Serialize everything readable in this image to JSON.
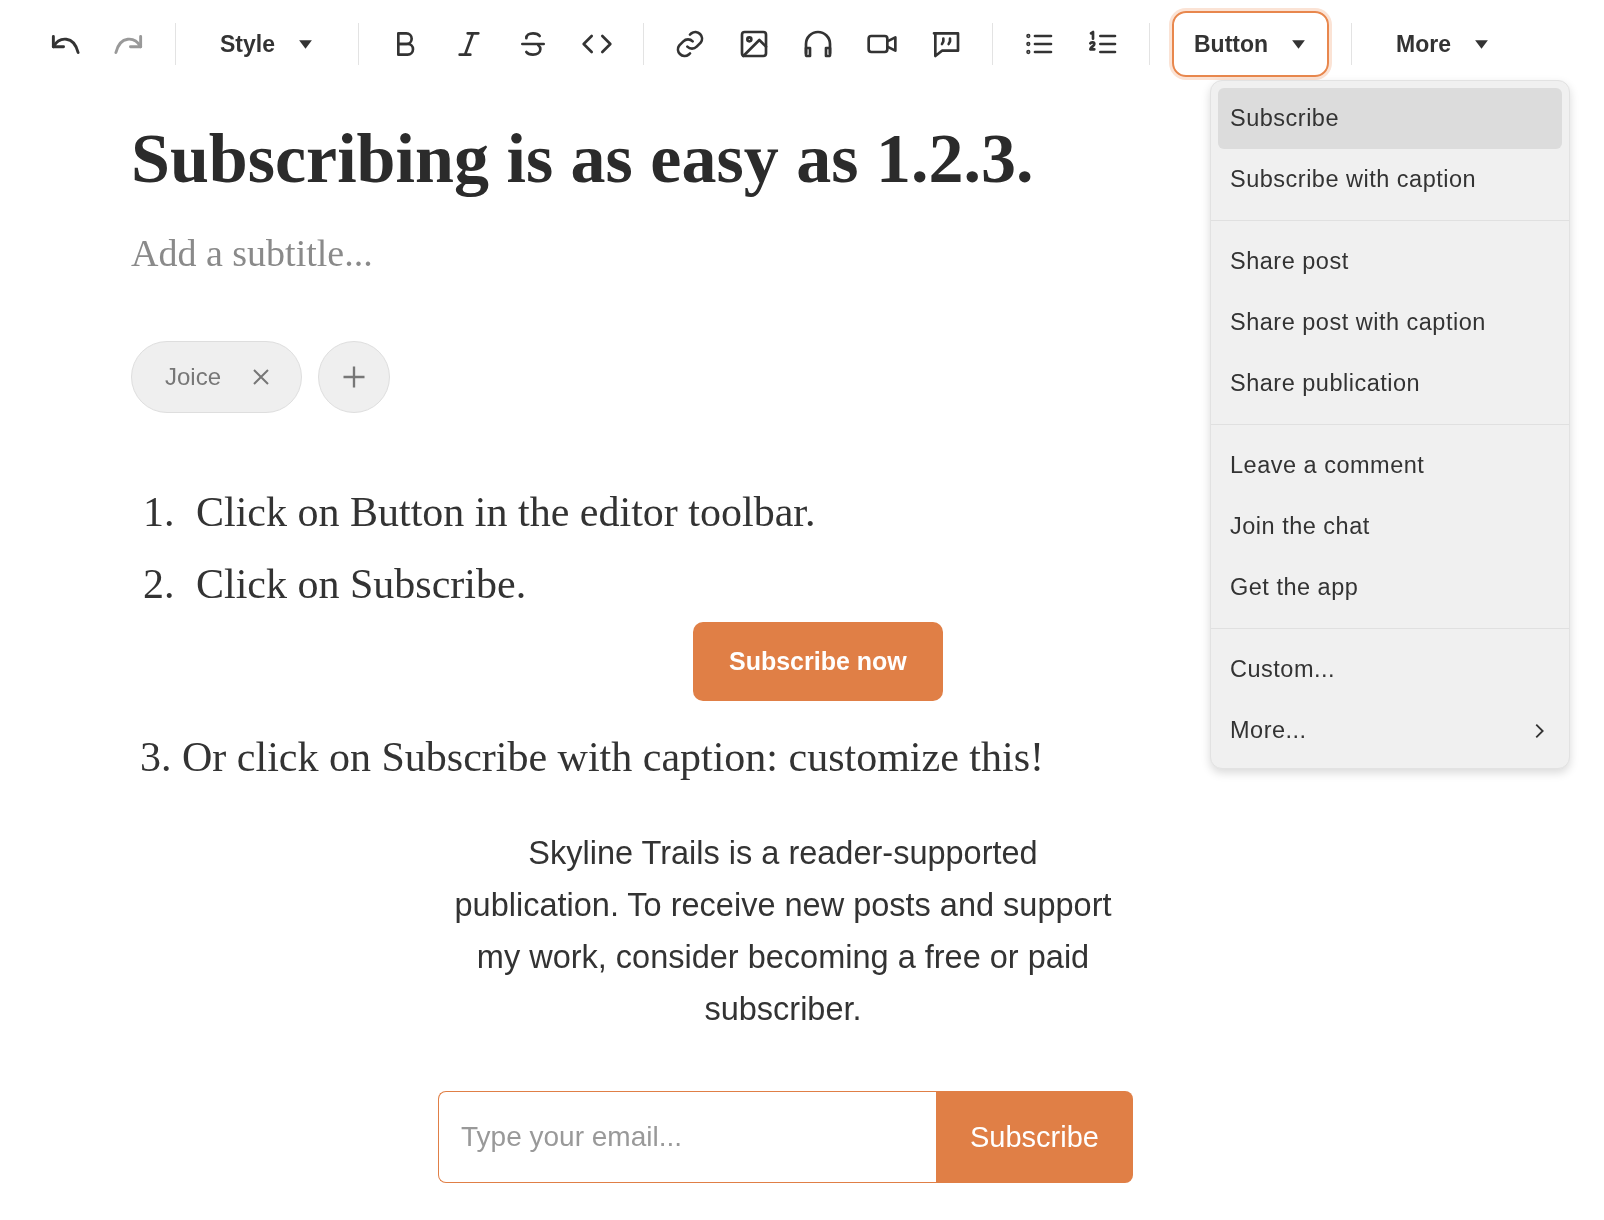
{
  "toolbar": {
    "groups": [
      [
        {
          "kind": "icon",
          "disabled": false
        },
        {
          "kind": "icon",
          "disabled": true
        }
      ],
      [
        {
          "kind": "dropdown",
          "label": "Style",
          "open": false
        }
      ],
      [
        {
          "kind": "icon",
          "disabled": false
        },
        {
          "kind": "icon",
          "disabled": false
        },
        {
          "kind": "icon",
          "disabled": false
        },
        {
          "kind": "icon",
          "disabled": false
        }
      ],
      [
        {
          "kind": "icon",
          "disabled": false
        },
        {
          "kind": "icon",
          "disabled": false
        },
        {
          "kind": "icon",
          "disabled": false
        },
        {
          "kind": "icon",
          "disabled": false
        },
        {
          "kind": "icon",
          "disabled": false
        }
      ],
      [
        {
          "kind": "icon",
          "disabled": false
        },
        {
          "kind": "icon",
          "disabled": false
        }
      ],
      [
        {
          "kind": "dropdown",
          "label": "Button",
          "open": true
        }
      ],
      [
        {
          "kind": "dropdown",
          "label": "More",
          "open": false
        }
      ]
    ]
  },
  "menu": {
    "groups": [
      [
        {
          "label": "Subscribe",
          "selected": true,
          "submenu": false
        },
        {
          "label": "Subscribe with caption",
          "selected": false,
          "submenu": false
        }
      ],
      [
        {
          "label": "Share post",
          "selected": false,
          "submenu": false
        },
        {
          "label": "Share post with caption",
          "selected": false,
          "submenu": false
        },
        {
          "label": "Share publication",
          "selected": false,
          "submenu": false
        }
      ],
      [
        {
          "label": "Leave a comment",
          "selected": false,
          "submenu": false
        },
        {
          "label": "Join the chat",
          "selected": false,
          "submenu": false
        },
        {
          "label": "Get the app",
          "selected": false,
          "submenu": false
        }
      ],
      [
        {
          "label": "Custom...",
          "selected": false,
          "submenu": false
        },
        {
          "label": "More...",
          "selected": false,
          "submenu": true
        }
      ]
    ]
  },
  "post": {
    "title": "Subscribing is as easy as 1.2.3.",
    "subtitle": {
      "placeholder": "Add a subtitle..."
    },
    "tags": [
      {
        "label": "Joice"
      }
    ],
    "steps": [
      {
        "number": "1.",
        "text": "Click on Button in the editor toolbar."
      },
      {
        "number": "2.",
        "text": "Click on Subscribe."
      }
    ],
    "subscribe_button": "Subscribe now",
    "step_3": "3. Or click on Subscribe with caption: customize this!",
    "caption": "Skyline Trails is a reader-supported publication. To receive new posts and support my work, consider becoming a free or paid subscriber.",
    "email_form": {
      "placeholder": "Type your email...",
      "button": "Subscribe"
    }
  }
}
